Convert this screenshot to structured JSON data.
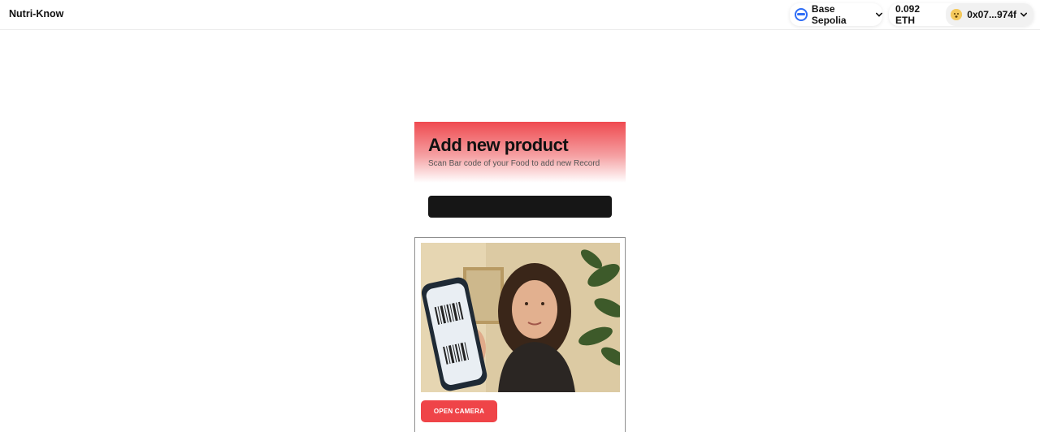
{
  "app": {
    "title": "Nutri-Know"
  },
  "wallet": {
    "network": "Base Sepolia",
    "balance": "0.092 ETH",
    "address": "0x07...974f",
    "network_icon": "base-network-icon",
    "avatar_icon": "emoji-avatar-icon"
  },
  "card": {
    "title": "Add new product",
    "subtitle": "Scan Bar code of your Food to add new Record",
    "open_camera_label": "OPEN CAMERA"
  },
  "colors": {
    "accent": "#ef4448",
    "network_blue": "#2f6df6",
    "dark_bar": "#161616"
  }
}
